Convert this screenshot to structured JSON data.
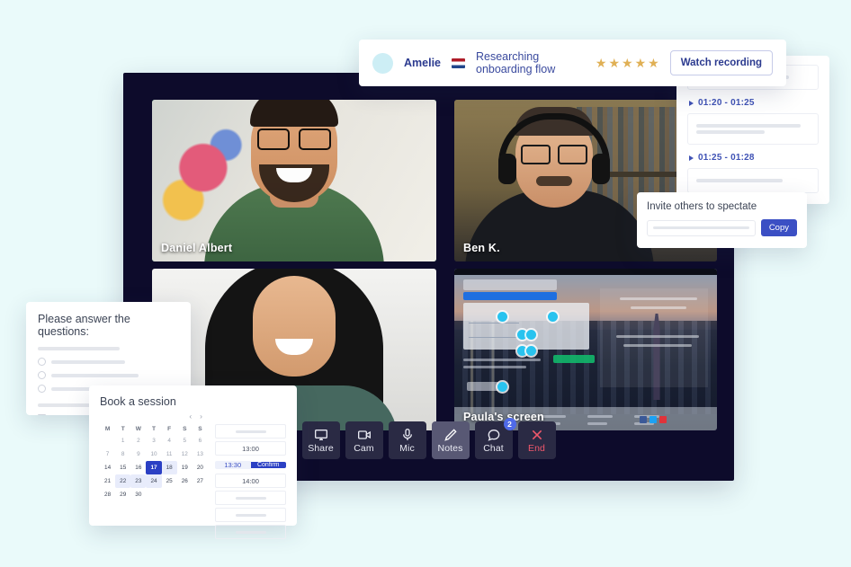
{
  "header": {
    "avatar": "user-avatar",
    "name": "Amelie",
    "flag": "netherlands-flag",
    "topic": "Researching onboarding flow",
    "rating": 5,
    "star_color": "#e0b055",
    "watch_label": "Watch recording"
  },
  "notes_panel": {
    "entries": [
      {
        "time": "01:20 - 01:25"
      },
      {
        "time": "01:25 - 01:28"
      }
    ]
  },
  "invite": {
    "title": "Invite others to spectate",
    "link_value": "",
    "copy_label": "Copy"
  },
  "questions": {
    "title": "Please answer the questions:",
    "radio_count": 3,
    "checkbox_count": 3
  },
  "booking": {
    "title": "Book a session",
    "prev_label": "‹",
    "next_label": "›",
    "weekdays": [
      "M",
      "T",
      "W",
      "T",
      "F",
      "S",
      "S"
    ],
    "weeks": [
      [
        "",
        "1",
        "2",
        "3",
        "4",
        "5",
        "6"
      ],
      [
        "7",
        "8",
        "9",
        "10",
        "11",
        "12",
        "13"
      ],
      [
        "14",
        "15",
        "16",
        "17",
        "18",
        "19",
        "20"
      ],
      [
        "21",
        "22",
        "23",
        "24",
        "25",
        "26",
        "27"
      ],
      [
        "28",
        "29",
        "30",
        "",
        "",
        "",
        ""
      ]
    ],
    "selected_day": "17",
    "highlighted_days": [
      "18",
      "22",
      "23",
      "24"
    ],
    "slots": [
      {
        "label": "",
        "state": "blank"
      },
      {
        "label": "13:00",
        "state": "available"
      },
      {
        "label": "13:30",
        "state": "selected"
      },
      {
        "label": "14:00",
        "state": "available"
      },
      {
        "label": "",
        "state": "blank"
      },
      {
        "label": "",
        "state": "blank"
      },
      {
        "label": "",
        "state": "blank"
      }
    ],
    "confirm_label": "Confirm"
  },
  "meeting": {
    "tiles": [
      {
        "name": "Daniel Albert",
        "active_speaker": true
      },
      {
        "name": "Ben K.",
        "active_speaker": false
      },
      {
        "name": "",
        "active_speaker": false
      },
      {
        "name": "Paula's screen",
        "active_speaker": false
      }
    ],
    "controls": [
      {
        "label": "Share",
        "icon": "monitor-icon",
        "state": "off"
      },
      {
        "label": "Cam",
        "icon": "camera-icon",
        "state": "off"
      },
      {
        "label": "Mic",
        "icon": "microphone-icon",
        "state": "off"
      },
      {
        "label": "Notes",
        "icon": "pencil-icon",
        "state": "on"
      },
      {
        "label": "Chat",
        "icon": "chat-bubble-icon",
        "state": "off",
        "badge": "2"
      },
      {
        "label": "End",
        "icon": "close-icon",
        "state": "end"
      }
    ]
  },
  "colors": {
    "page_background": "#eafafa",
    "meeting_background": "#0d0b2b",
    "accent_blue": "#2b40c4",
    "active_speaker": "#3ddc6d",
    "end_red": "#f0576b"
  }
}
